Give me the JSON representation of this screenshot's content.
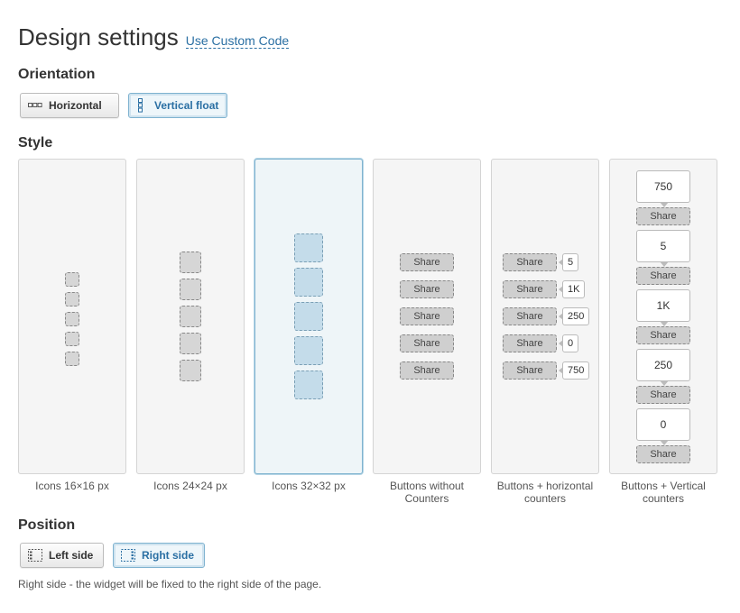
{
  "header": {
    "title": "Design settings",
    "custom_code_link": "Use Custom Code"
  },
  "orientation": {
    "heading": "Orientation",
    "options": [
      {
        "label": "Horizontal",
        "selected": false
      },
      {
        "label": "Vertical float",
        "selected": true
      }
    ]
  },
  "style": {
    "heading": "Style",
    "cards": [
      {
        "caption": "Icons 16×16 px",
        "selected": false
      },
      {
        "caption": "Icons 24×24 px",
        "selected": false
      },
      {
        "caption": "Icons 32×32 px",
        "selected": true
      },
      {
        "caption": "Buttons without Counters",
        "selected": false
      },
      {
        "caption": "Buttons + horizontal counters",
        "selected": false
      },
      {
        "caption": "Buttons + Vertical counters",
        "selected": false
      }
    ],
    "share_label": "Share",
    "horizontal_counts": [
      "5",
      "1K",
      "250",
      "0",
      "750"
    ],
    "vertical_counts": [
      "750",
      "5",
      "1K",
      "250",
      "0"
    ]
  },
  "position": {
    "heading": "Position",
    "options": [
      {
        "label": "Left side",
        "selected": false
      },
      {
        "label": "Right side",
        "selected": true
      }
    ],
    "description": "Right side - the widget will be fixed to the right side of the page."
  },
  "colors": {
    "link": "#2a6fa3",
    "selected_border": "#7fb3d0",
    "selected_bg": "#eef6fa"
  }
}
